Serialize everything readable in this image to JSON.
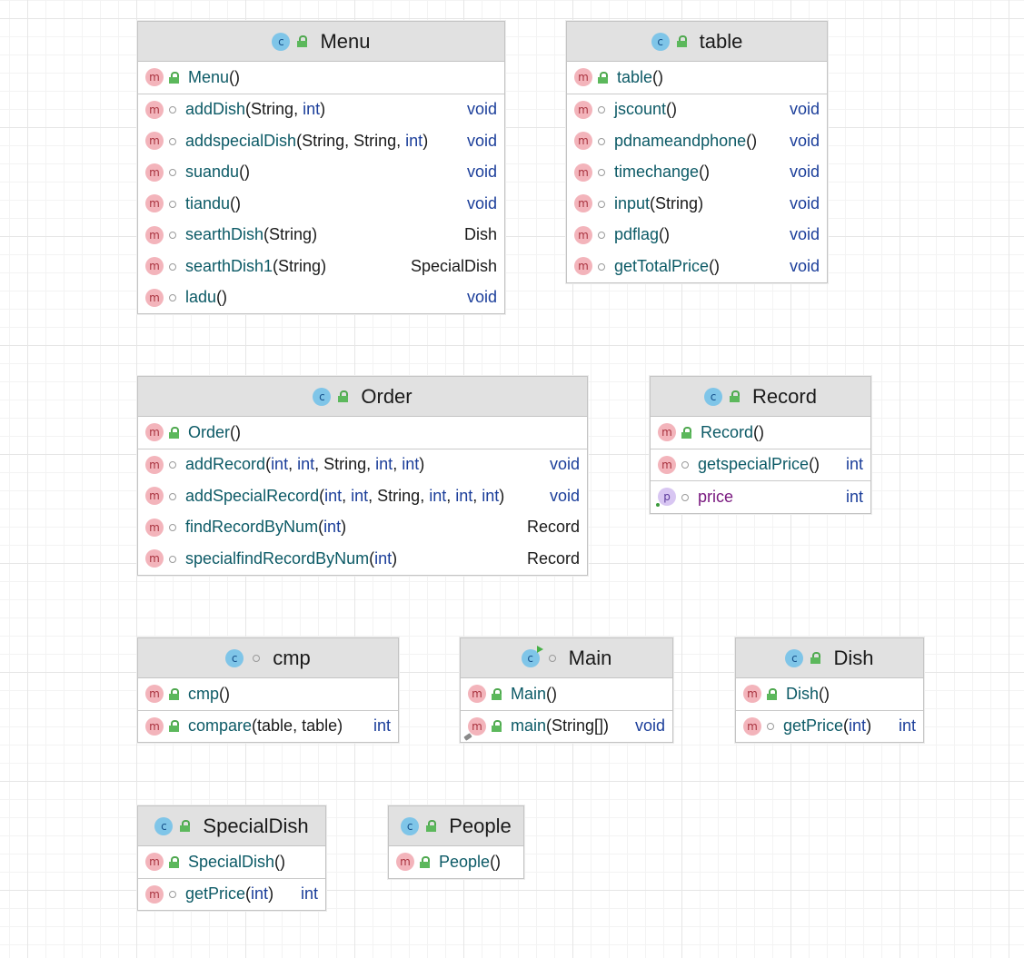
{
  "classes": {
    "menu": {
      "name": "Menu",
      "members": [
        {
          "name": "Menu",
          "params": [
            "()"
          ],
          "ret": ""
        },
        {
          "name": "addDish",
          "params": [
            "(",
            "String",
            ", ",
            "int",
            ")"
          ],
          "ret": "void"
        },
        {
          "name": "addspecialDish",
          "params": [
            "(",
            "String",
            ", ",
            "String",
            ", ",
            "int",
            ")"
          ],
          "ret": "void"
        },
        {
          "name": "suandu",
          "params": [
            "()"
          ],
          "ret": "void"
        },
        {
          "name": "tiandu",
          "params": [
            "()"
          ],
          "ret": "void"
        },
        {
          "name": "searthDish",
          "params": [
            "(",
            "String",
            ")"
          ],
          "ret": "Dish"
        },
        {
          "name": "searthDish1",
          "params": [
            "(",
            "String",
            ")"
          ],
          "ret": "SpecialDish"
        },
        {
          "name": "ladu",
          "params": [
            "()"
          ],
          "ret": "void"
        }
      ]
    },
    "table": {
      "name": "table",
      "members": [
        {
          "name": "table",
          "params": [
            "()"
          ],
          "ret": ""
        },
        {
          "name": "jscount",
          "params": [
            "()"
          ],
          "ret": "void"
        },
        {
          "name": "pdnameandphone",
          "params": [
            "()"
          ],
          "ret": "void"
        },
        {
          "name": "timechange",
          "params": [
            "()"
          ],
          "ret": "void"
        },
        {
          "name": "input",
          "params": [
            "(",
            "String",
            ")"
          ],
          "ret": "void"
        },
        {
          "name": "pdflag",
          "params": [
            "()"
          ],
          "ret": "void"
        },
        {
          "name": "getTotalPrice",
          "params": [
            "()"
          ],
          "ret": "void"
        }
      ]
    },
    "order": {
      "name": "Order",
      "members": [
        {
          "name": "Order",
          "params": [
            "()"
          ],
          "ret": ""
        },
        {
          "name": "addRecord",
          "params": [
            "(",
            "int",
            ", ",
            "int",
            ", ",
            "String",
            ", ",
            "int",
            ", ",
            "int",
            ")"
          ],
          "ret": "void"
        },
        {
          "name": "addSpecialRecord",
          "params": [
            "(",
            "int",
            ", ",
            "int",
            ", ",
            "String",
            ", ",
            "int",
            ", ",
            "int",
            ", ",
            "int",
            ")"
          ],
          "ret": "void"
        },
        {
          "name": "findRecordByNum",
          "params": [
            "(",
            "int",
            ")"
          ],
          "ret": "Record"
        },
        {
          "name": "specialfindRecordByNum",
          "params": [
            "(",
            "int",
            ")"
          ],
          "ret": "Record"
        }
      ]
    },
    "record": {
      "name": "Record",
      "members": [
        {
          "name": "Record",
          "params": [
            "()"
          ],
          "ret": ""
        },
        {
          "name": "getspecialPrice",
          "params": [
            "()"
          ],
          "ret": "int"
        },
        {
          "name": "price",
          "params": [],
          "ret": "int"
        }
      ]
    },
    "cmp": {
      "name": "cmp",
      "members": [
        {
          "name": "cmp",
          "params": [
            "()"
          ],
          "ret": ""
        },
        {
          "name": "compare",
          "params": [
            "(",
            "table",
            ", ",
            "table",
            ")"
          ],
          "ret": "int"
        }
      ]
    },
    "main": {
      "name": "Main",
      "members": [
        {
          "name": "Main",
          "params": [
            "()"
          ],
          "ret": ""
        },
        {
          "name": "main",
          "params": [
            "(",
            "String[]",
            ")"
          ],
          "ret": "void"
        }
      ]
    },
    "dish": {
      "name": "Dish",
      "members": [
        {
          "name": "Dish",
          "params": [
            "()"
          ],
          "ret": ""
        },
        {
          "name": "getPrice",
          "params": [
            "(",
            "int",
            ")"
          ],
          "ret": "int"
        }
      ]
    },
    "specialdish": {
      "name": "SpecialDish",
      "members": [
        {
          "name": "SpecialDish",
          "params": [
            "()"
          ],
          "ret": ""
        },
        {
          "name": "getPrice",
          "params": [
            "(",
            "int",
            ")"
          ],
          "ret": "int"
        }
      ]
    },
    "people": {
      "name": "People",
      "members": [
        {
          "name": "People",
          "params": [
            "()"
          ],
          "ret": ""
        }
      ]
    }
  },
  "keywords": [
    "int",
    "void"
  ],
  "badge_letters": {
    "method": "m",
    "class": "c",
    "field": "p"
  },
  "icons": {
    "class": "class-icon",
    "method": "method-icon",
    "field": "field-icon",
    "public": "public-lock-icon",
    "package": "package-private-icon",
    "run": "run-icon"
  },
  "colors": {
    "method_name": "#0c5a66",
    "field_name": "#7a1a80",
    "keyword": "#1b3e9a",
    "header_bg": "#e1e1e1",
    "method_badge": "#f3b4bb",
    "class_badge": "#7fc5e8"
  }
}
